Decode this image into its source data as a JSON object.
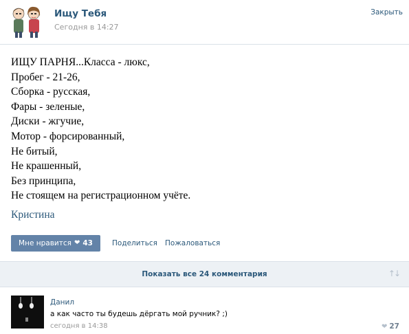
{
  "header": {
    "group_name": "Ищу Тебя",
    "date": "Сегодня в 14:27",
    "close_label": "Закрыть"
  },
  "post": {
    "lines": [
      "ИЩУ ПАРНЯ...Класса - люкс,",
      "Пробег - 21-26,",
      "Сборка - русская,",
      "Фары - зеленые,",
      "Диски - жгучие,",
      "Мотор - форсированный,",
      "Не битый,",
      "Не крашенный,",
      "Без принципа,",
      "Не стоящем на регистрационном учёте."
    ],
    "signature": "Кристина"
  },
  "actions": {
    "like_label": "Мне нравится",
    "like_icon": "heart-icon",
    "like_count": "43",
    "share_label": "Поделиться",
    "report_label": "Пожаловаться"
  },
  "comments_bar": {
    "show_all_label": "Показать все 24 комментария",
    "sort_icon": "sort-arrows-icon"
  },
  "comment": {
    "author": "Данил",
    "text": "а как часто ты будешь дёргать мой ручник? ;)",
    "date": "сегодня в 14:38",
    "likes": "27",
    "like_icon": "heart-icon"
  },
  "colors": {
    "link": "#2b587a",
    "button": "#6383a8",
    "bar": "#edf1f5",
    "muted": "#999999"
  }
}
